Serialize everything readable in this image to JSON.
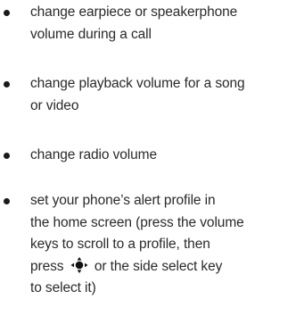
{
  "bullets": [
    {
      "lines": [
        "change earpiece or speakerphone",
        "volume during a call"
      ]
    },
    {
      "lines": [
        "change playback volume for a song",
        "or video"
      ]
    },
    {
      "lines": [
        "change radio volume"
      ]
    },
    {
      "lines": [
        "set your phone’s alert profile in",
        "the home screen (press the volume",
        "keys to scroll to a profile, then"
      ],
      "press_prefix": "press",
      "press_icon": "nav-key-icon",
      "press_suffix": "or the side select key",
      "last_line": "to select it)"
    }
  ]
}
